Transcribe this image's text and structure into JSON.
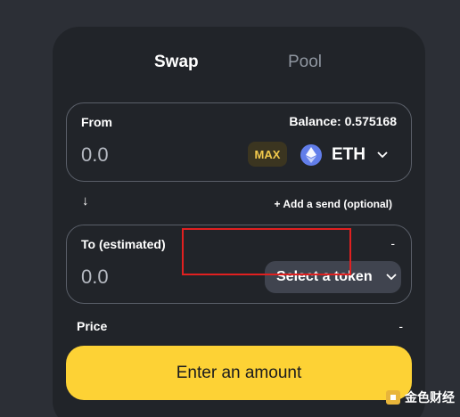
{
  "tabs": [
    {
      "label": "Swap",
      "active": true
    },
    {
      "label": "Pool",
      "active": false
    }
  ],
  "from": {
    "label": "From",
    "balance": "Balance: 0.575168",
    "amount_placeholder": "0.0",
    "max_label": "MAX",
    "token_symbol": "ETH",
    "token_icon": "eth-icon"
  },
  "middle": {
    "arrow_icon": "arrow-down-icon",
    "arrow_glyph": "↓",
    "add_send_label": "+ Add a send (optional)"
  },
  "to": {
    "label": "To (estimated)",
    "right_value": "-",
    "amount_placeholder": "0.0",
    "select_token_label": "Select a token"
  },
  "price": {
    "label": "Price",
    "value": "-"
  },
  "submit": {
    "label": "Enter an amount"
  },
  "watermark": {
    "text": "金色财经"
  },
  "colors": {
    "background": "#2c2f36",
    "card": "#212429",
    "accent_button": "#fdd235",
    "max_text": "#f2c94c",
    "highlight_border": "#e02020",
    "eth_icon": "#627eea"
  }
}
